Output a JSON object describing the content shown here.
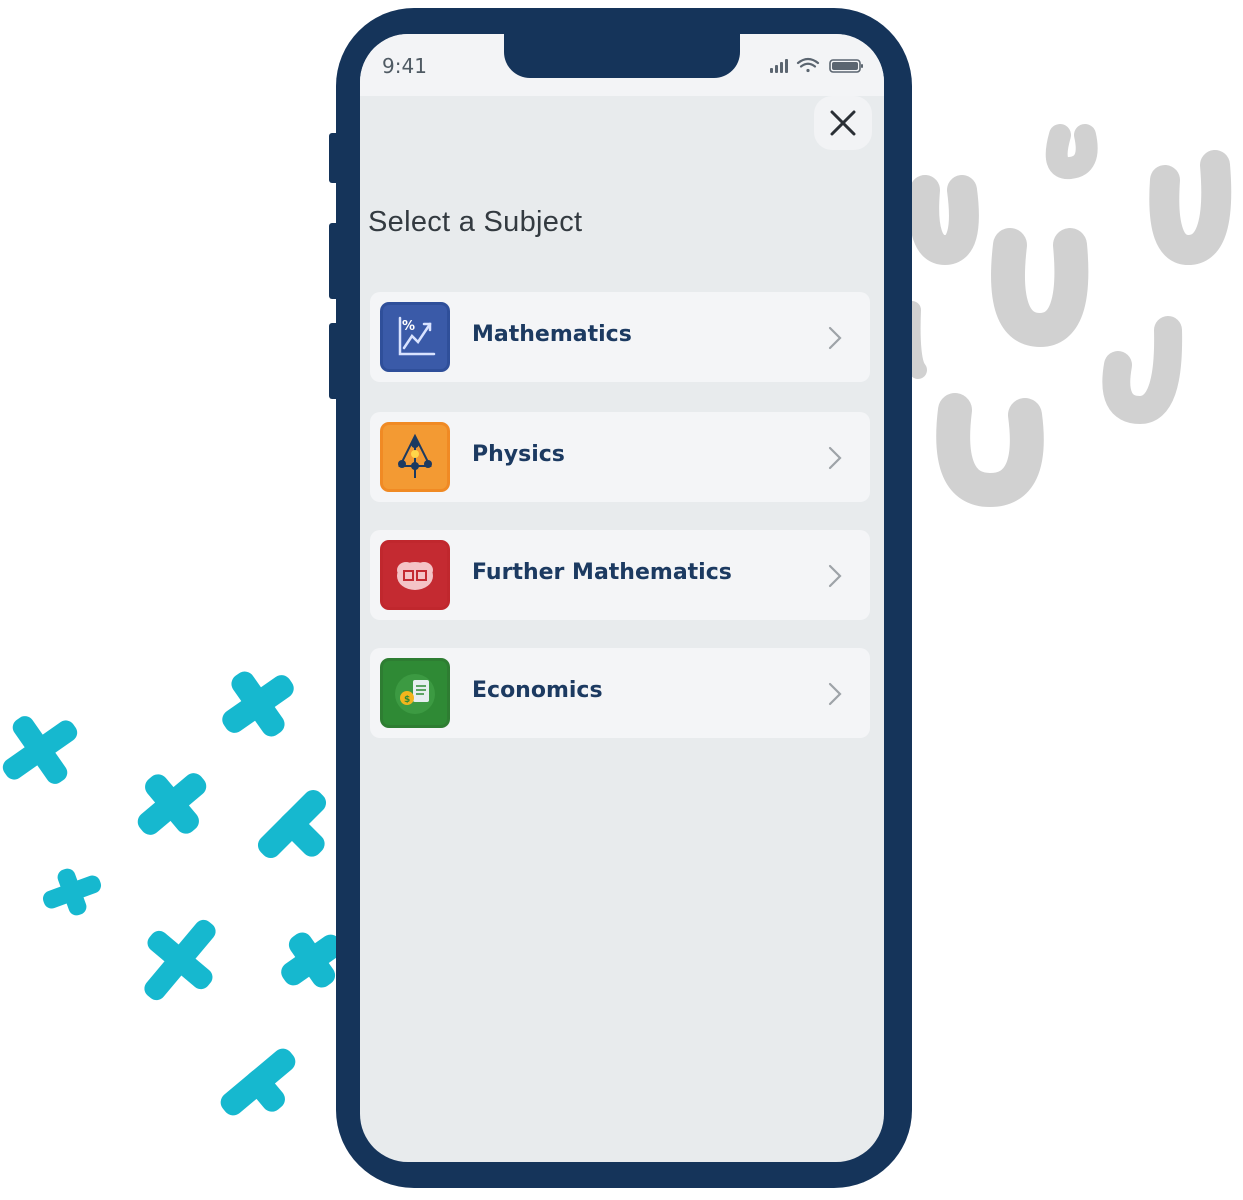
{
  "status_bar": {
    "time": "9:41"
  },
  "modal": {
    "close_icon": "close-icon",
    "title": "Select a Subject"
  },
  "subjects": [
    {
      "label": "Mathematics",
      "icon": "mathematics-icon",
      "color": "#2f4f9a"
    },
    {
      "label": "Physics",
      "icon": "physics-icon",
      "color": "#f08a24"
    },
    {
      "label": "Further Mathematics",
      "icon": "further-mathematics-icon",
      "color": "#c0272d"
    },
    {
      "label": "Economics",
      "icon": "economics-icon",
      "color": "#2e7d32"
    }
  ],
  "colors": {
    "phone_frame": "#15345a",
    "screen_bg": "#e8ebed",
    "row_bg": "#f4f5f7",
    "label_text": "#1c3a61",
    "decor_teal": "#16b8cf",
    "decor_gray": "#d1d1d1"
  }
}
